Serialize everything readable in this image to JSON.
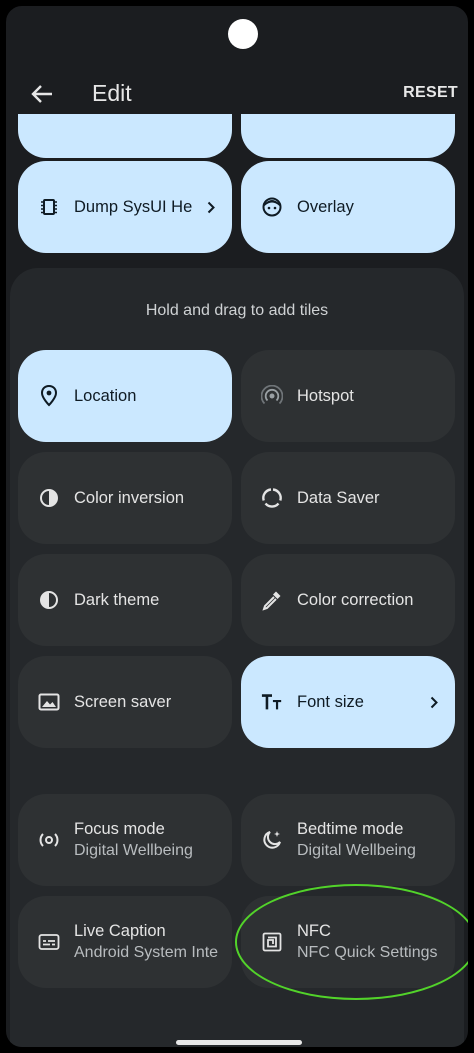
{
  "header": {
    "title": "Edit",
    "reset_label": "RESET"
  },
  "current_tiles": [
    {
      "label": "Dump SysUI He",
      "icon": "memory-chip-icon",
      "chevron": true,
      "state": "on"
    },
    {
      "label": "Overlay",
      "icon": "overlay-face-icon",
      "chevron": false,
      "state": "on"
    }
  ],
  "available": {
    "hint": "Hold and drag to add tiles",
    "tiles": [
      {
        "label": "Location",
        "icon": "location-pin-icon",
        "state": "on"
      },
      {
        "label": "Hotspot",
        "icon": "hotspot-icon",
        "state": "off"
      },
      {
        "label": "Color inversion",
        "icon": "color-inversion-icon",
        "state": "off"
      },
      {
        "label": "Data Saver",
        "icon": "data-saver-icon",
        "state": "off"
      },
      {
        "label": "Dark theme",
        "icon": "dark-theme-icon",
        "state": "off"
      },
      {
        "label": "Color correction",
        "icon": "eyedropper-icon",
        "state": "off"
      },
      {
        "label": "Screen saver",
        "icon": "screen-saver-icon",
        "state": "off"
      },
      {
        "label": "Font size",
        "icon": "font-size-icon",
        "state": "on"
      },
      {
        "label": "Focus mode",
        "sublabel": "Digital Wellbeing",
        "icon": "focus-mode-icon",
        "state": "off"
      },
      {
        "label": "Bedtime mode",
        "sublabel": "Digital Wellbeing",
        "icon": "bedtime-mode-icon",
        "state": "off"
      },
      {
        "label": "Live Caption",
        "sublabel": "Android System Inte",
        "icon": "live-caption-icon",
        "state": "off"
      },
      {
        "label": "NFC",
        "sublabel": "NFC Quick Settings",
        "icon": "nfc-icon",
        "state": "off"
      }
    ]
  },
  "colors": {
    "tile_on": "#cbe8ff",
    "tile_off": "#2e3133",
    "panel": "#25282b",
    "highlight": "#52d32a"
  }
}
